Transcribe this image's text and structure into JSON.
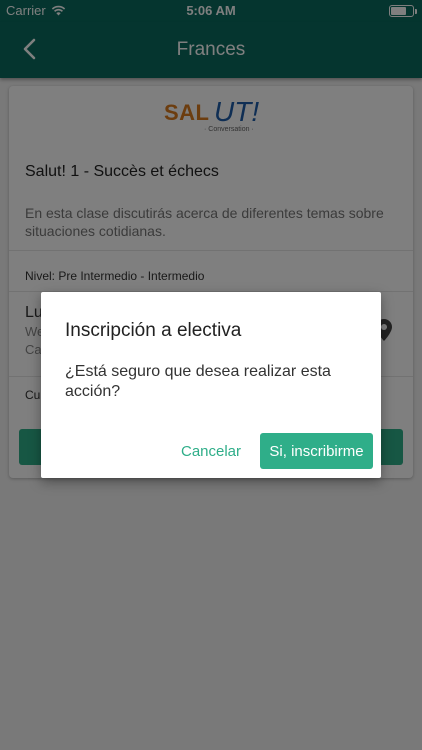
{
  "status_bar": {
    "carrier": "Carrier",
    "time": "5:06 AM"
  },
  "nav": {
    "title": "Frances",
    "back_icon": "chevron-left-icon"
  },
  "course": {
    "logo": {
      "sal": "SAL",
      "ut": "UT!",
      "subtitle": "· Conversation ·"
    },
    "title": "Salut! 1 - Succès et échecs",
    "description": "En esta clase discutirás acerca de diferentes temas sobre situaciones cotidianas.",
    "level": "Nivel: Pre Intermedio - Intermedio",
    "schedule_day": "Lu",
    "schedule_time": "We",
    "schedule_place": "Ca",
    "cupo": "Cu",
    "location_icon": "map-pin-icon"
  },
  "dialog": {
    "title": "Inscripción a electiva",
    "message": "¿Está seguro que desea realizar esta acción?",
    "cancel_label": "Cancelar",
    "confirm_label": "Si, inscribirme"
  },
  "colors": {
    "header": "#0a6b5e",
    "accent": "#2fae89"
  }
}
